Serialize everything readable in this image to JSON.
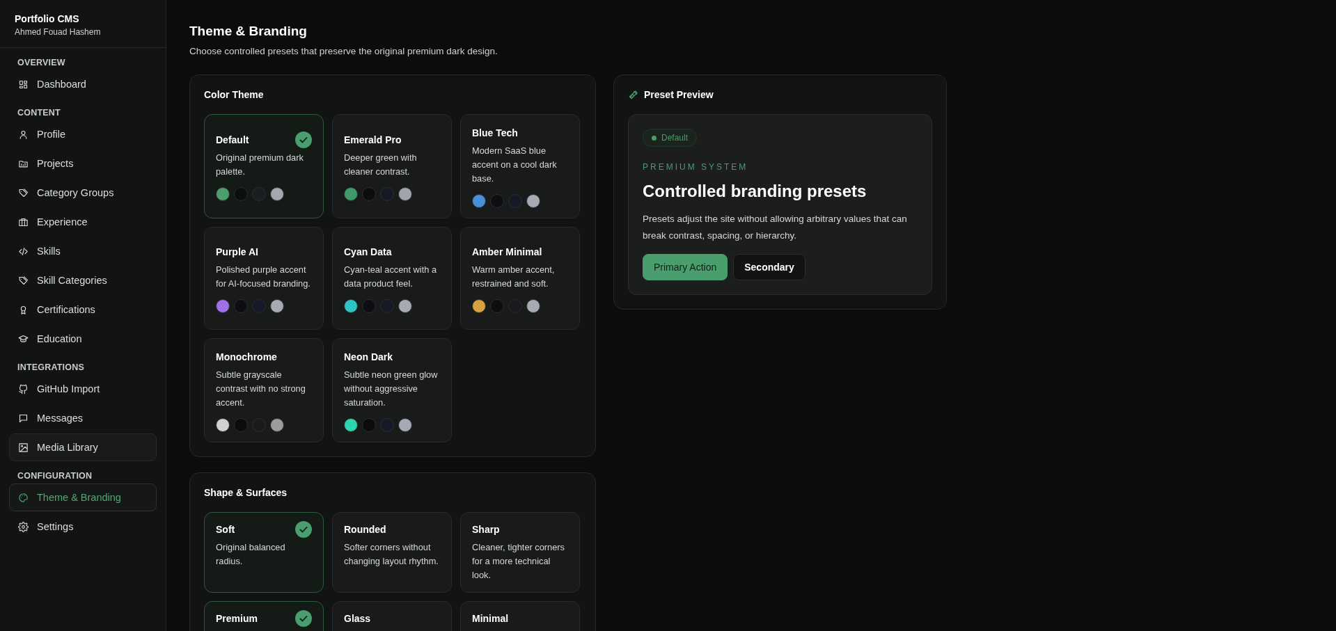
{
  "sidebar": {
    "brand": "Portfolio CMS",
    "owner": "Ahmed Fouad Hashem",
    "sections": [
      {
        "heading": "OVERVIEW",
        "items": [
          {
            "label": "Dashboard",
            "selected": false,
            "hovered": false
          }
        ]
      },
      {
        "heading": "CONTENT",
        "items": [
          {
            "label": "Profile",
            "selected": false,
            "hovered": false
          },
          {
            "label": "Projects",
            "selected": false,
            "hovered": false
          },
          {
            "label": "Category Groups",
            "selected": false,
            "hovered": false
          },
          {
            "label": "Experience",
            "selected": false,
            "hovered": false
          },
          {
            "label": "Skills",
            "selected": false,
            "hovered": false
          },
          {
            "label": "Skill Categories",
            "selected": false,
            "hovered": false
          },
          {
            "label": "Certifications",
            "selected": false,
            "hovered": false
          },
          {
            "label": "Education",
            "selected": false,
            "hovered": false
          }
        ]
      },
      {
        "heading": "INTEGRATIONS",
        "items": [
          {
            "label": "GitHub Import",
            "selected": false,
            "hovered": false
          },
          {
            "label": "Messages",
            "selected": false,
            "hovered": false
          },
          {
            "label": "Media Library",
            "selected": false,
            "hovered": true
          }
        ]
      },
      {
        "heading": "CONFIGURATION",
        "items": [
          {
            "label": "Theme & Branding",
            "selected": true,
            "hovered": false
          },
          {
            "label": "Settings",
            "selected": false,
            "hovered": false
          }
        ]
      }
    ]
  },
  "page": {
    "title": "Theme & Branding",
    "subtitle": "Choose controlled presets that preserve the original premium dark design."
  },
  "color_theme": {
    "title": "Color Theme",
    "presets": [
      {
        "name": "Default",
        "description": "Original premium dark palette.",
        "selected": true,
        "swatches": [
          {
            "color": "#4c9e6c"
          },
          {
            "color": "#0d0e10"
          },
          {
            "color": "#1c1d22"
          },
          {
            "color": "#a4a8ae"
          }
        ]
      },
      {
        "name": "Emerald Pro",
        "description": "Deeper green with cleaner contrast.",
        "selected": false,
        "swatches": [
          {
            "color": "#3f9a68"
          },
          {
            "color": "#0c0d0f"
          },
          {
            "color": "#161a24"
          },
          {
            "color": "#a0a4ab"
          }
        ]
      },
      {
        "name": "Blue Tech",
        "description": "Modern SaaS blue accent on a cool dark base.",
        "selected": false,
        "swatches": [
          {
            "color": "#4a90d9"
          },
          {
            "color": "#0d0e11"
          },
          {
            "color": "#141a28"
          },
          {
            "color": "#a5aab3"
          }
        ]
      },
      {
        "name": "Purple AI",
        "description": "Polished purple accent for AI-focused branding.",
        "selected": false,
        "swatches": [
          {
            "color": "#a070e8"
          },
          {
            "color": "#0d0e11"
          },
          {
            "color": "#171a2a"
          },
          {
            "color": "#a5aab3"
          }
        ]
      },
      {
        "name": "Cyan Data",
        "description": "Cyan-teal accent with a data product feel.",
        "selected": false,
        "swatches": [
          {
            "color": "#2ec4c4"
          },
          {
            "color": "#0d0e11"
          },
          {
            "color": "#171a24"
          },
          {
            "color": "#a5aab3"
          }
        ]
      },
      {
        "name": "Amber Minimal",
        "description": "Warm amber accent, restrained and soft.",
        "selected": false,
        "swatches": [
          {
            "color": "#d9a040"
          },
          {
            "color": "#0d0e10"
          },
          {
            "color": "#1a1b20"
          },
          {
            "color": "#a5aab3"
          }
        ]
      },
      {
        "name": "Monochrome",
        "description": "Subtle grayscale contrast with no strong accent.",
        "selected": false,
        "swatches": [
          {
            "color": "#cfd1d4"
          },
          {
            "color": "#0b0c0e"
          },
          {
            "color": "#1a1b1d"
          },
          {
            "color": "#9a9ca0"
          }
        ]
      },
      {
        "name": "Neon Dark",
        "description": "Subtle neon green glow without aggressive saturation.",
        "selected": false,
        "swatches": [
          {
            "color": "#2dd4b0"
          },
          {
            "color": "#0b0c0e"
          },
          {
            "color": "#151a28"
          },
          {
            "color": "#a5aab3"
          }
        ]
      }
    ]
  },
  "shape_surfaces": {
    "title": "Shape & Surfaces",
    "presets": [
      {
        "name": "Soft",
        "description": "Original balanced radius.",
        "selected": true
      },
      {
        "name": "Rounded",
        "description": "Softer corners without changing layout rhythm.",
        "selected": false
      },
      {
        "name": "Sharp",
        "description": "Cleaner, tighter corners for a more technical look.",
        "selected": false
      },
      {
        "name": "Premium",
        "selected": true
      },
      {
        "name": "Glass",
        "selected": false
      },
      {
        "name": "Minimal",
        "selected": false
      }
    ]
  },
  "preview": {
    "title": "Preset Preview",
    "badge": "Default",
    "eyebrow": "PREMIUM SYSTEM",
    "heading": "Controlled branding presets",
    "body": "Presets adjust the site without allowing arbitrary values that can break contrast, spacing, or hierarchy.",
    "buttons": [
      {
        "label": "Primary Action",
        "kind": "primary"
      },
      {
        "label": "Secondary",
        "kind": "secondary"
      }
    ]
  }
}
